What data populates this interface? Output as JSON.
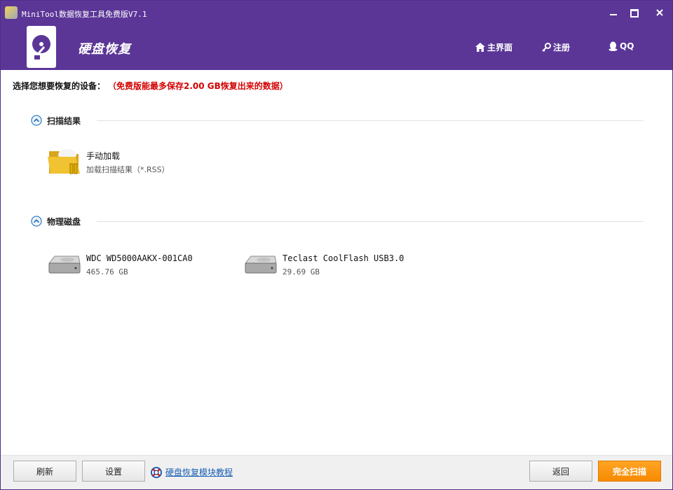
{
  "window": {
    "title": "MiniTool数据恢复工具免费版V7.1"
  },
  "header": {
    "module_title": "硬盘恢复",
    "nav": {
      "home": "主界面",
      "register": "注册",
      "qq": "QQ"
    }
  },
  "main": {
    "prompt": "选择您想要恢复的设备：",
    "prompt_note": "（免费版能最多保存2.00 GB恢复出来的数据）",
    "sections": {
      "scan_results": {
        "title": "扫描结果",
        "items": [
          {
            "name": "手动加载",
            "detail": "加载扫描结果（*.RSS）",
            "icon": "folder-icon"
          }
        ]
      },
      "physical_disks": {
        "title": "物理磁盘",
        "items": [
          {
            "name": "WDC WD5000AAKX-001CA0",
            "size": "465.76 GB",
            "icon": "hard-drive-icon"
          },
          {
            "name": "Teclast CoolFlash USB3.0",
            "size": "29.69 GB",
            "icon": "hard-drive-icon"
          }
        ]
      }
    }
  },
  "footer": {
    "refresh": "刷新",
    "settings": "设置",
    "help_link": "硬盘恢复模块教程",
    "back": "返回",
    "full_scan": "完全扫描"
  },
  "colors": {
    "titlebar": "#5b3697",
    "warning": "#d40000",
    "primary_button": "#f78a00",
    "link": "#1a5fb4"
  }
}
